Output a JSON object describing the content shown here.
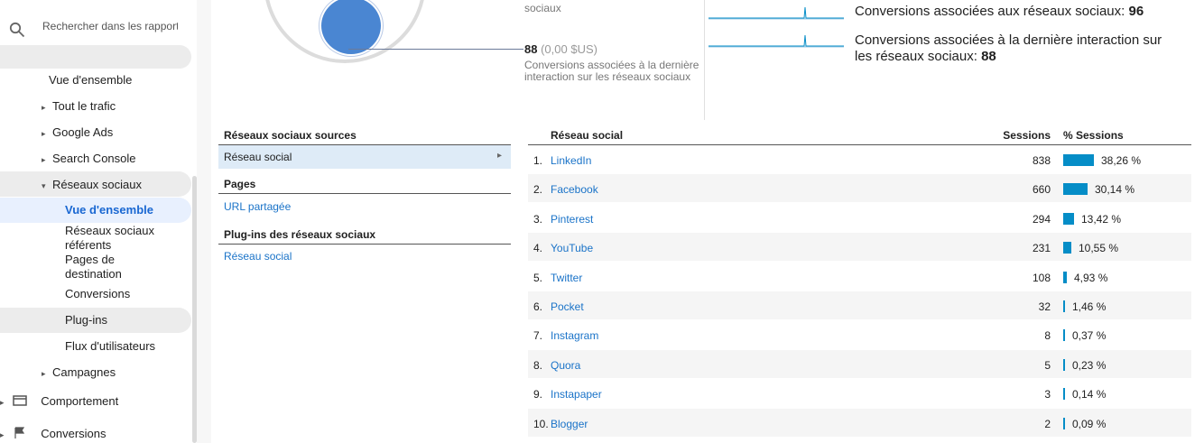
{
  "search": {
    "placeholder": "Rechercher dans les rapport"
  },
  "nav": {
    "overview": "Vue d'ensemble",
    "all_traffic": "Tout le trafic",
    "google_ads": "Google Ads",
    "search_console": "Search Console",
    "social": "Réseaux sociaux",
    "social_sub": {
      "overview": "Vue d'ensemble",
      "referrals_1": "Réseaux sociaux",
      "referrals_2": "référents",
      "landing_1": "Pages de",
      "landing_2": "destination",
      "conversions": "Conversions",
      "plugins": "Plug-ins",
      "user_flow": "Flux d'utilisateurs"
    },
    "campaigns": "Campagnes",
    "behavior": "Comportement",
    "conversions": "Conversions"
  },
  "summary": {
    "top_partial": "sociaux",
    "last_interaction_count": "88",
    "last_interaction_value": "(0,00 $US)",
    "last_interaction_label_1": "Conversions associées à la dernière",
    "last_interaction_label_2": "interaction sur les réseaux sociaux",
    "assisted_label": "Conversions associées aux réseaux sociaux:",
    "assisted_value": "96",
    "last_label_1": "Conversions associées à la dernière interaction sur",
    "last_label_2": "les réseaux sociaux:",
    "last_value": "88"
  },
  "sources": {
    "head_sources": "Réseaux sociaux sources",
    "social_network": "Réseau social",
    "head_pages": "Pages",
    "shared_url": "URL partagée",
    "head_plugins": "Plug-ins des réseaux sociaux",
    "plugin_social": "Réseau social"
  },
  "table": {
    "col_name": "Réseau social",
    "col_sessions": "Sessions",
    "col_pct": "% Sessions",
    "rows": [
      {
        "rank": "1.",
        "name": "LinkedIn",
        "sessions": "838",
        "pct_label": "38,26 %",
        "pct": 38.26
      },
      {
        "rank": "2.",
        "name": "Facebook",
        "sessions": "660",
        "pct_label": "30,14 %",
        "pct": 30.14
      },
      {
        "rank": "3.",
        "name": "Pinterest",
        "sessions": "294",
        "pct_label": "13,42 %",
        "pct": 13.42
      },
      {
        "rank": "4.",
        "name": "YouTube",
        "sessions": "231",
        "pct_label": "10,55 %",
        "pct": 10.55
      },
      {
        "rank": "5.",
        "name": "Twitter",
        "sessions": "108",
        "pct_label": "4,93 %",
        "pct": 4.93
      },
      {
        "rank": "6.",
        "name": "Pocket",
        "sessions": "32",
        "pct_label": "1,46 %",
        "pct": 1.46
      },
      {
        "rank": "7.",
        "name": "Instagram",
        "sessions": "8",
        "pct_label": "0,37 %",
        "pct": 0.37
      },
      {
        "rank": "8.",
        "name": "Quora",
        "sessions": "5",
        "pct_label": "0,23 %",
        "pct": 0.23
      },
      {
        "rank": "9.",
        "name": "Instapaper",
        "sessions": "3",
        "pct_label": "0,14 %",
        "pct": 0.14
      },
      {
        "rank": "10.",
        "name": "Blogger",
        "sessions": "2",
        "pct_label": "0,09 %",
        "pct": 0.09
      }
    ]
  },
  "colors": {
    "accent": "#058dc7",
    "link": "#1a73c8",
    "active": "#1967d2",
    "donut": "#4a86d2"
  }
}
